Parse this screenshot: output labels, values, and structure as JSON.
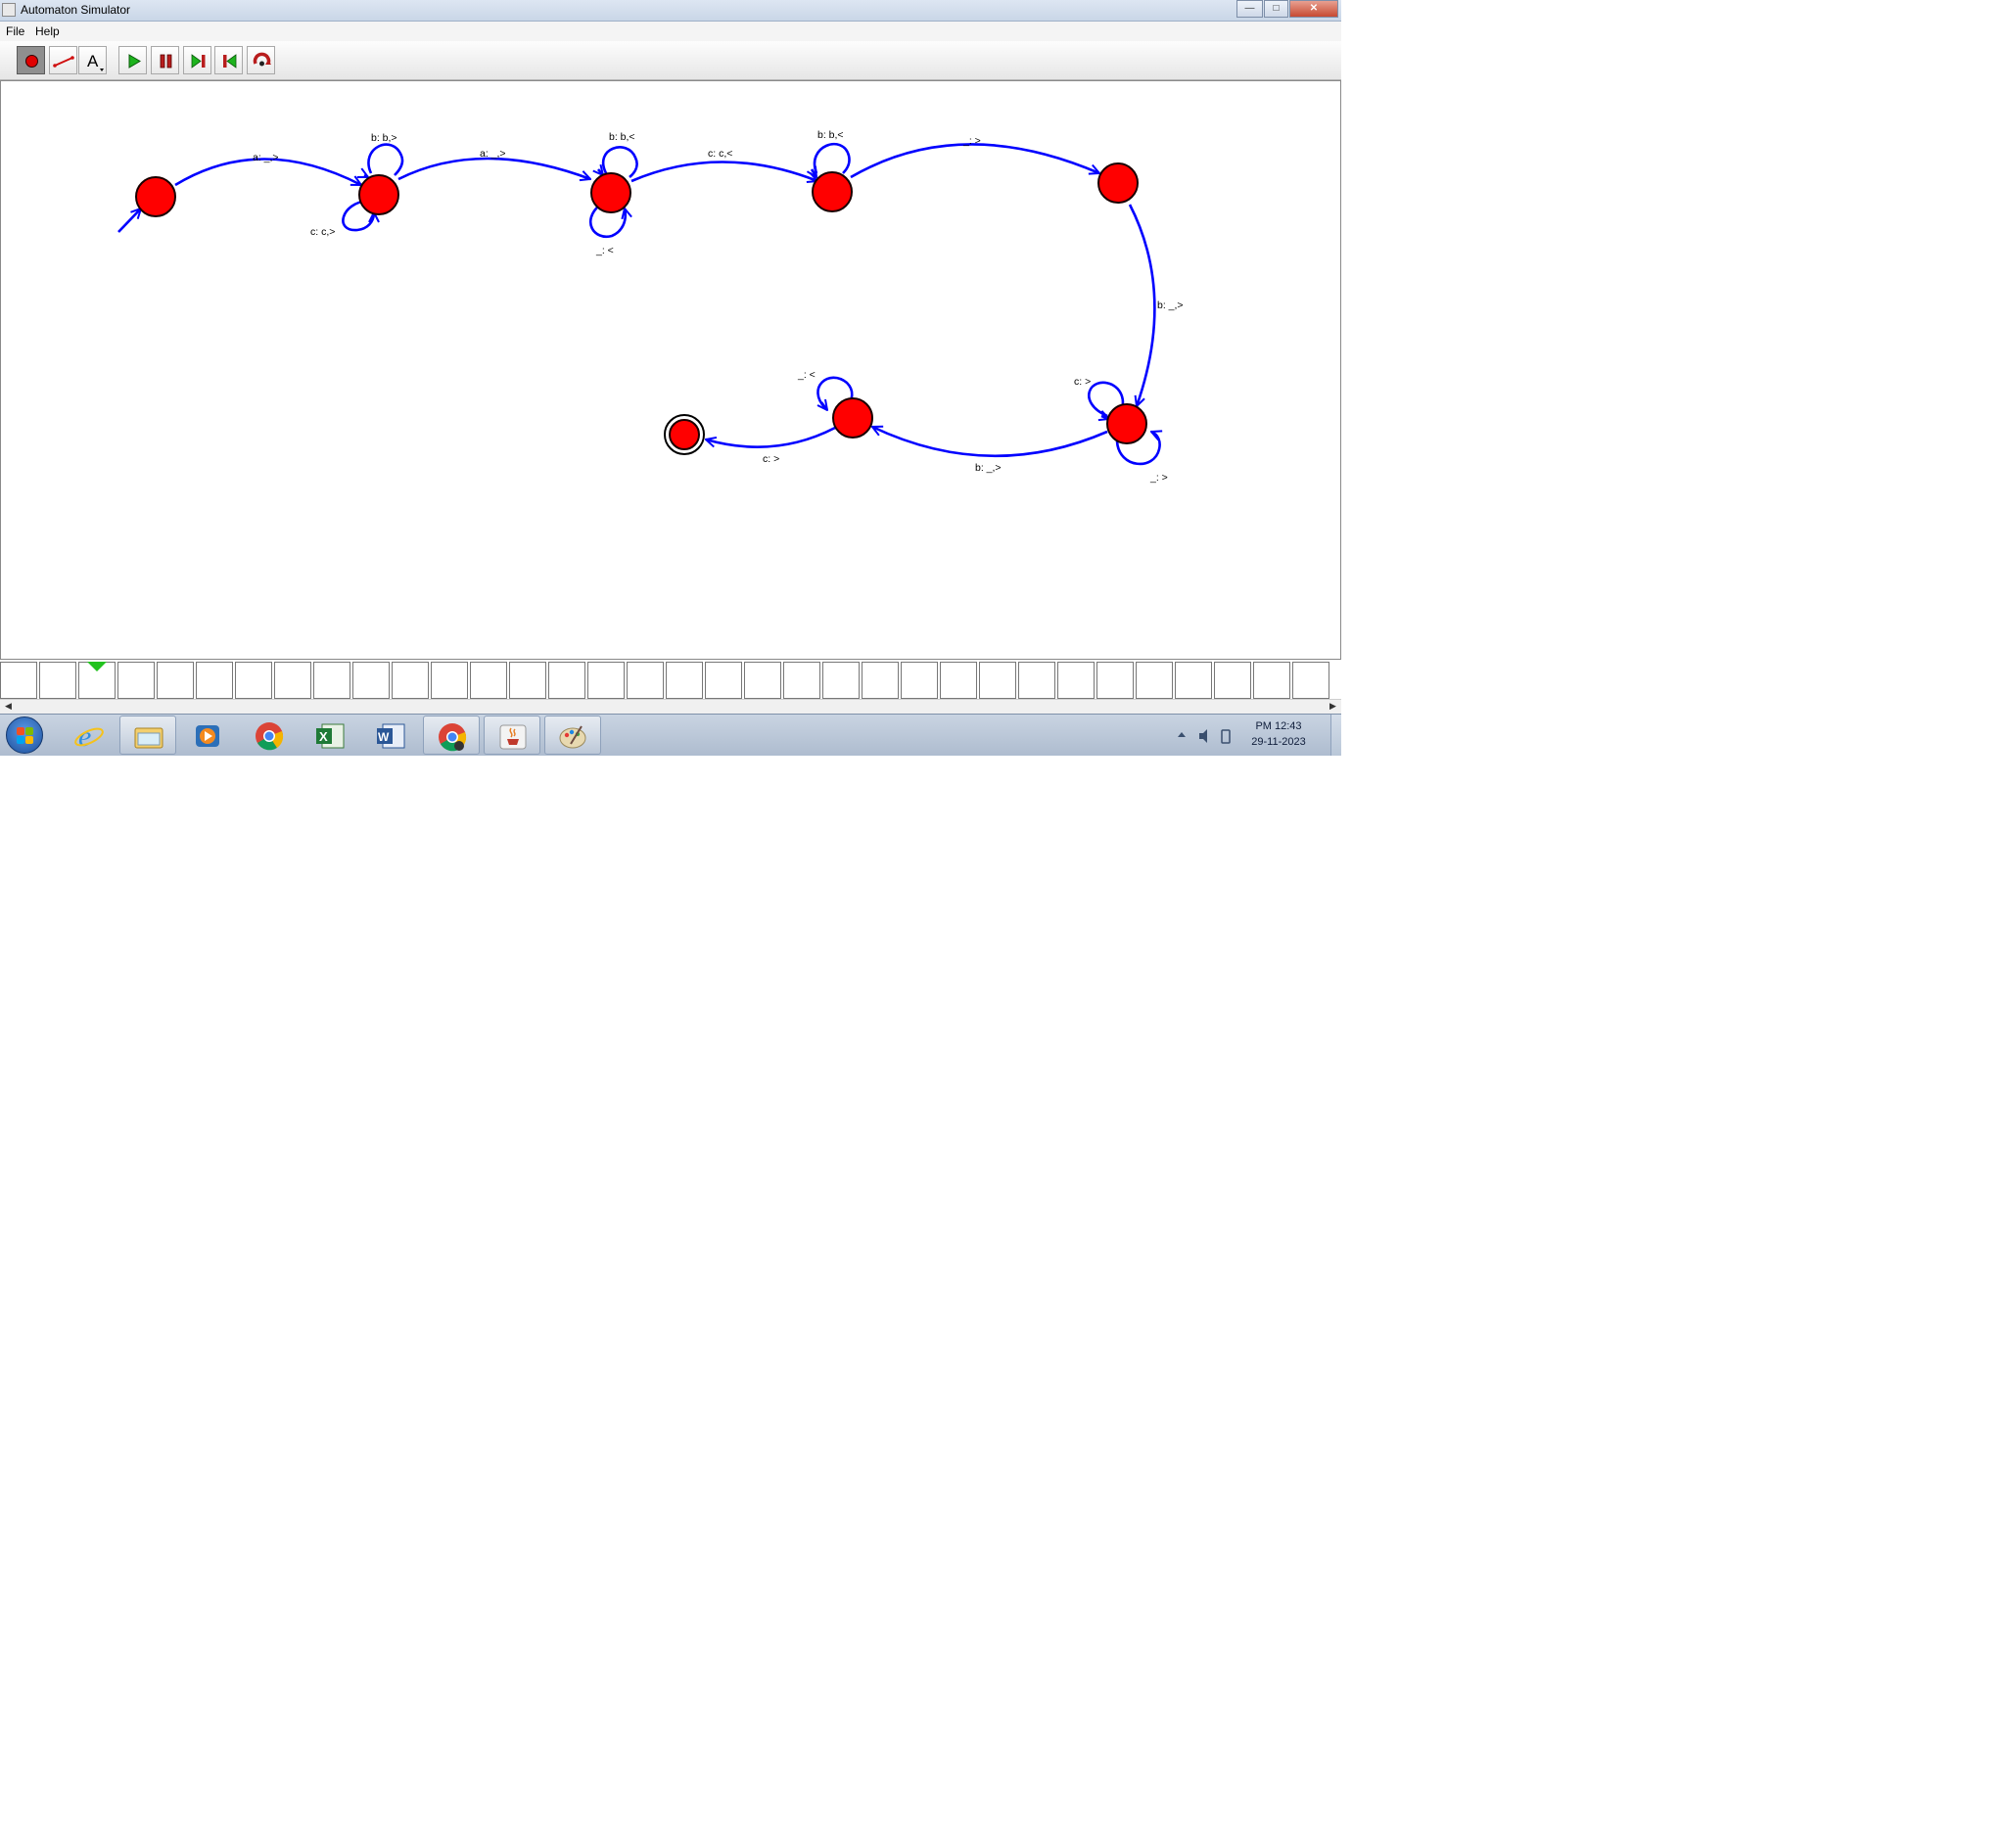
{
  "window": {
    "title": "Automaton Simulator",
    "buttons": {
      "minimize": "—",
      "maximize": "□",
      "close": "✕"
    }
  },
  "menu": [
    {
      "label": "File"
    },
    {
      "label": "Help"
    }
  ],
  "toolbar": {
    "tools": [
      {
        "name": "state-tool",
        "icon": "red-dot-icon",
        "active": true
      },
      {
        "name": "transition-tool",
        "icon": "line-icon",
        "active": false
      },
      {
        "name": "text-tool",
        "icon": "text-icon",
        "label": "A"
      }
    ],
    "controls": [
      {
        "name": "play",
        "icon": "play-icon",
        "color": "#1db31d"
      },
      {
        "name": "pause",
        "icon": "pause-icon",
        "color": "#b81d1d"
      },
      {
        "name": "step-forward",
        "icon": "step-forward-icon",
        "color": "#1db31d"
      },
      {
        "name": "step-back",
        "icon": "step-back-icon",
        "color": "#1db31d"
      },
      {
        "name": "reset",
        "icon": "reset-icon",
        "color": "#b81d1d"
      }
    ]
  },
  "automaton": {
    "state_color": "#ff0000",
    "edge_color": "#0000ff",
    "transitions": {
      "q0_q1": "a: _,>",
      "q1_loop_top": "b: b,>",
      "q1_loop_bottom": "c: c,>",
      "q1_q2": "a: _,>",
      "q2_loop_top": "b: b,<",
      "q2_loop_bottom": "_: <",
      "q2_q3": "c: c,<",
      "q3_loop_top": "b: b,<",
      "q3_q4": "_: >",
      "q4_q5": "b: _,>",
      "q5_loop_top": "c: >",
      "q5_loop_bottom": "_: >",
      "q5_q6": "b: _,>",
      "q6_loop_top": "_: <",
      "q6_q7": "c: >"
    }
  },
  "tape": {
    "cell_count": 34,
    "head_index": 2,
    "head_color": "#22c21e"
  },
  "taskbar": {
    "apps": [
      {
        "name": "internet-explorer",
        "icon": "ie-icon"
      },
      {
        "name": "file-explorer",
        "icon": "folder-icon"
      },
      {
        "name": "media-player",
        "icon": "media-icon"
      },
      {
        "name": "chrome",
        "icon": "chrome-icon"
      },
      {
        "name": "excel",
        "icon": "excel-icon"
      },
      {
        "name": "word",
        "icon": "word-icon"
      },
      {
        "name": "chrome-user",
        "icon": "chrome-icon"
      },
      {
        "name": "java",
        "icon": "java-icon"
      },
      {
        "name": "paint",
        "icon": "paint-icon"
      }
    ],
    "clock": {
      "time": "PM 12:43",
      "date": "29-11-2023"
    }
  }
}
